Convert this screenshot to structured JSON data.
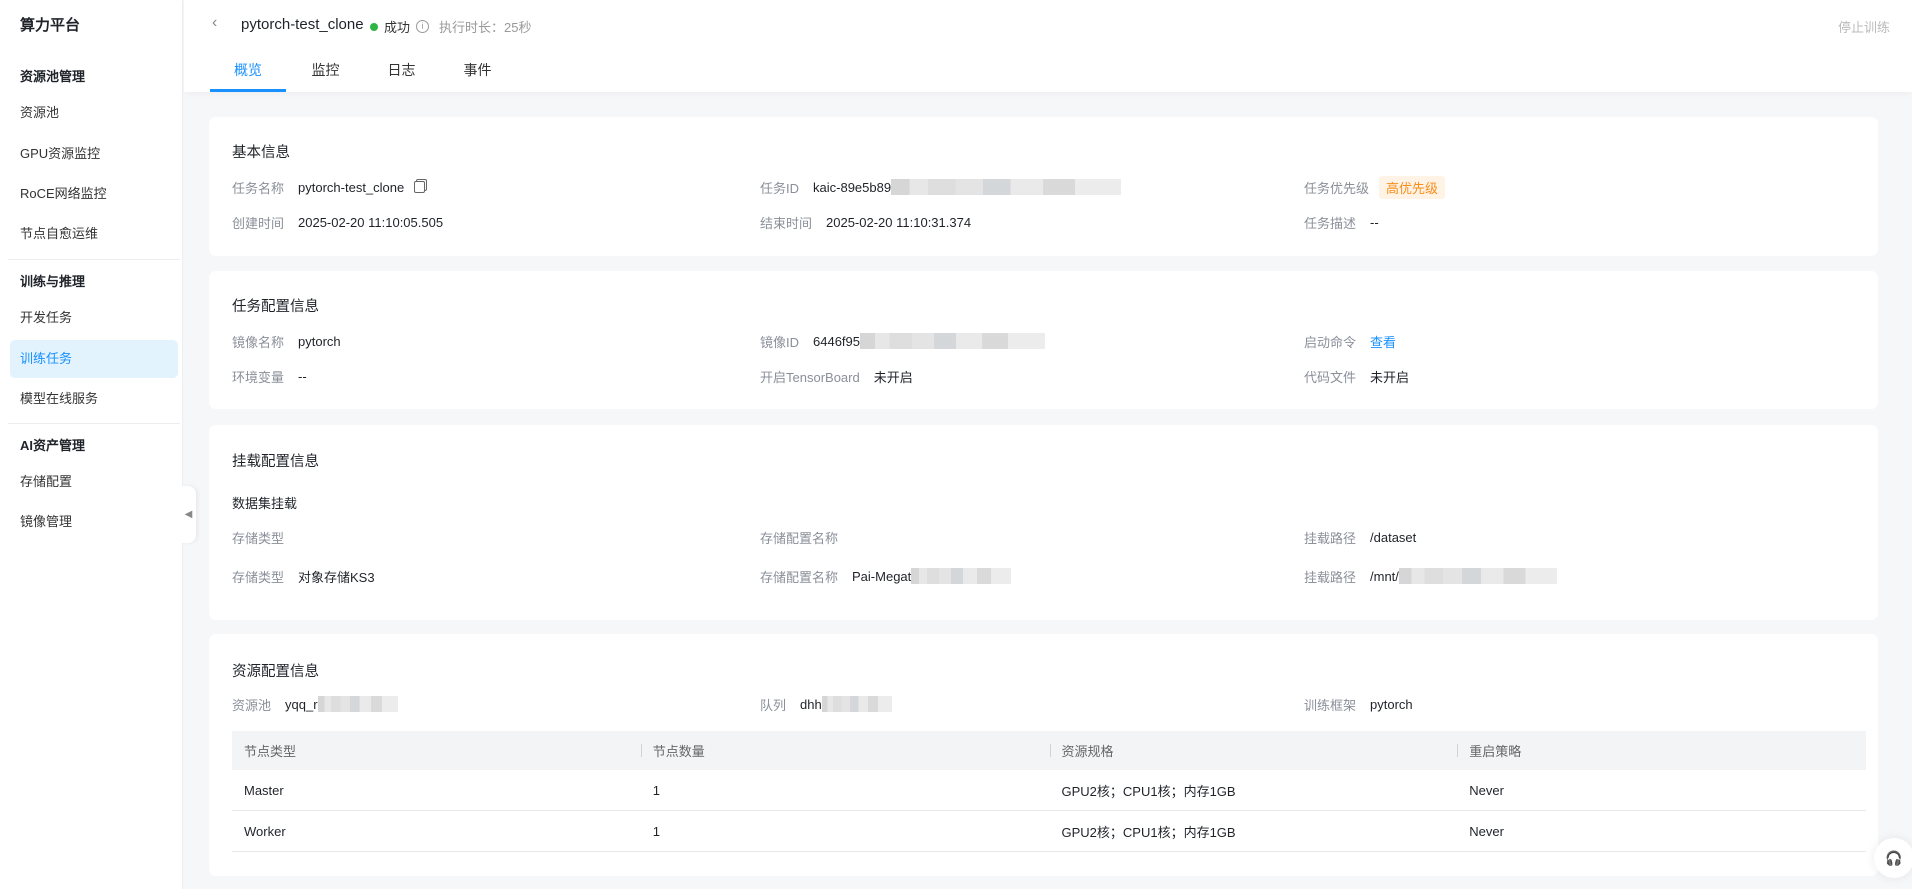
{
  "sidebar": {
    "title": "算力平台",
    "sections": [
      {
        "label": "资源池管理",
        "items": [
          "资源池",
          "GPU资源监控",
          "RoCE网络监控",
          "节点自愈运维"
        ]
      },
      {
        "label": "训练与推理",
        "items": [
          "开发任务",
          "训练任务",
          "模型在线服务"
        ]
      },
      {
        "label": "AI资产管理",
        "items": [
          "存储配置",
          "镜像管理"
        ]
      }
    ],
    "active": "训练任务"
  },
  "header": {
    "title": "pytorch-test_clone",
    "status": "成功",
    "duration": "执行时长：25秒",
    "stop_button": "停止训练",
    "tabs": [
      "概览",
      "监控",
      "日志",
      "事件"
    ]
  },
  "basic": {
    "title": "基本信息",
    "task_name_label": "任务名称",
    "task_name": "pytorch-test_clone",
    "task_id_label": "任务ID",
    "task_id": "kaic-89e5b89",
    "priority_label": "任务优先级",
    "priority": "高优先级",
    "created_label": "创建时间",
    "created": "2025-02-20 11:10:05.505",
    "ended_label": "结束时间",
    "ended": "2025-02-20 11:10:31.374",
    "desc_label": "任务描述",
    "desc": "--"
  },
  "config": {
    "title": "任务配置信息",
    "image_name_label": "镜像名称",
    "image_name": "pytorch",
    "image_id_label": "镜像ID",
    "image_id": "6446f95",
    "cmd_label": "启动命令",
    "cmd_link": "查看",
    "env_label": "环境变量",
    "env": "--",
    "tb_label": "开启TensorBoard",
    "tb": "未开启",
    "code_label": "代码文件",
    "code": "未开启"
  },
  "mount": {
    "title": "挂载配置信息",
    "subtitle": "数据集挂载",
    "rows": [
      {
        "type_label": "存储类型",
        "type": "",
        "name_label": "存储配置名称",
        "name": "",
        "path_label": "挂载路径",
        "path": "/dataset"
      },
      {
        "type_label": "存储类型",
        "type": "对象存储KS3",
        "name_label": "存储配置名称",
        "name": "Pai-Megat",
        "path_label": "挂载路径",
        "path": "/mnt/"
      }
    ]
  },
  "resource": {
    "title": "资源配置信息",
    "pool_label": "资源池",
    "pool": "yqq_r",
    "queue_label": "队列",
    "queue": "dhh",
    "framework_label": "训练框架",
    "framework": "pytorch",
    "columns": [
      "节点类型",
      "节点数量",
      "资源规格",
      "重启策略"
    ],
    "rows": [
      [
        "Master",
        "1",
        "GPU2核；CPU1核；内存1GB",
        "Never"
      ],
      [
        "Worker",
        "1",
        "GPU2核；CPU1核；内存1GB",
        "Never"
      ]
    ]
  }
}
